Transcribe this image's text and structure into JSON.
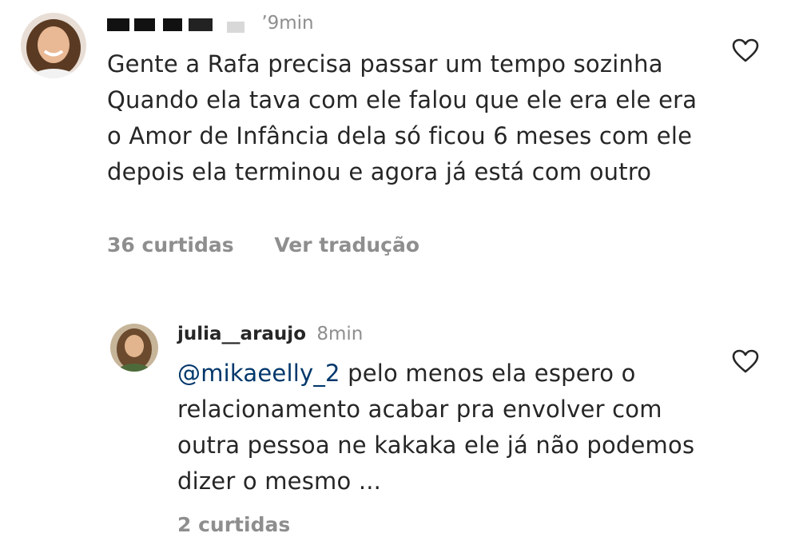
{
  "comments": [
    {
      "username": "",
      "time": "’9min",
      "text": "Gente a Rafa precisa passar um tempo sozinha Quando ela tava com ele falou que ele era ele era o Amor de Infância dela só ficou 6 meses com ele depois ela terminou e agora já está com outro",
      "likes": "36 curtidas",
      "translate": "Ver tradução",
      "icons": {
        "like": "heart-outline-icon",
        "avatar": "profile-photo"
      }
    },
    {
      "username": "julia__araujo",
      "time": "8min",
      "mention": "@mikaeelly_2",
      "text": " pelo menos ela espero o relacionamento acabar pra envolver com outra pessoa ne kakaka ele já não podemos dizer o mesmo ...",
      "likes": "2 curtidas",
      "icons": {
        "like": "heart-outline-icon",
        "avatar": "profile-photo"
      }
    }
  ],
  "colors": {
    "text": "#262626",
    "muted": "#8e8e8e",
    "mention": "#00376b"
  }
}
